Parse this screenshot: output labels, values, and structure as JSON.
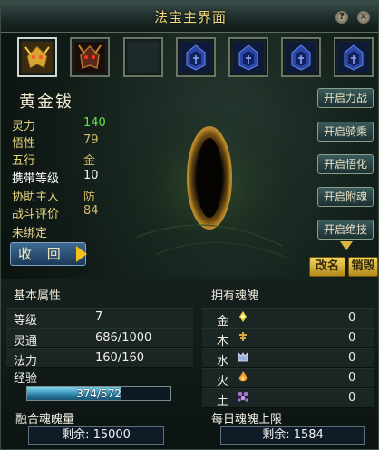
{
  "window": {
    "title": "法宝主界面"
  },
  "titlebar": {
    "help_glyph": "?",
    "close_glyph": "×"
  },
  "slots": [
    {
      "icon": "golden-dragon-helm",
      "active": true
    },
    {
      "icon": "red-demon-helm",
      "active": false
    },
    {
      "icon": "empty-slot",
      "active": false
    },
    {
      "icon": "locked-blue-slot",
      "active": false
    },
    {
      "icon": "locked-blue-slot",
      "active": false
    },
    {
      "icon": "locked-blue-slot",
      "active": false
    },
    {
      "icon": "locked-blue-slot",
      "active": false
    }
  ],
  "item": {
    "name": "黄金钹",
    "stats": [
      {
        "label": "灵力",
        "value": "140"
      },
      {
        "label": "悟性",
        "value": "79"
      },
      {
        "label": "五行",
        "value": "金"
      },
      {
        "label": "携带等级",
        "value": "10"
      },
      {
        "label": "协助主人",
        "value": "防"
      },
      {
        "label": "战斗评价",
        "value": "84"
      }
    ],
    "bind_status": "未绑定",
    "recall_label": "收 回"
  },
  "actions": {
    "buttons": [
      "开启力战",
      "开启骑乘",
      "开启悟化",
      "开启附魂",
      "开启绝技"
    ],
    "rename_label": "改名",
    "destroy_label": "销毁"
  },
  "basic": {
    "title": "基本属性",
    "rows": [
      {
        "label": "等级",
        "value": "7"
      },
      {
        "label": "灵通",
        "value": "686/1000"
      },
      {
        "label": "法力",
        "value": "160/160"
      }
    ],
    "exp_label": "经验",
    "exp_text": "374/572",
    "exp_fraction": 0.654,
    "fusion_title": "融合魂魄量",
    "fusion_remain": "剩余: 15000"
  },
  "souls": {
    "title": "拥有魂魄",
    "elements": [
      {
        "label": "金",
        "value": "0",
        "color": "#f2d24a"
      },
      {
        "label": "木",
        "value": "0",
        "color": "#d8a640"
      },
      {
        "label": "水",
        "value": "0",
        "color": "#9bb0d8"
      },
      {
        "label": "火",
        "value": "0",
        "color": "#f0a030"
      },
      {
        "label": "土",
        "value": "0",
        "color": "#a874d8"
      }
    ],
    "daily_title": "每日魂魄上限",
    "daily_remain": "剩余: 1584"
  }
}
